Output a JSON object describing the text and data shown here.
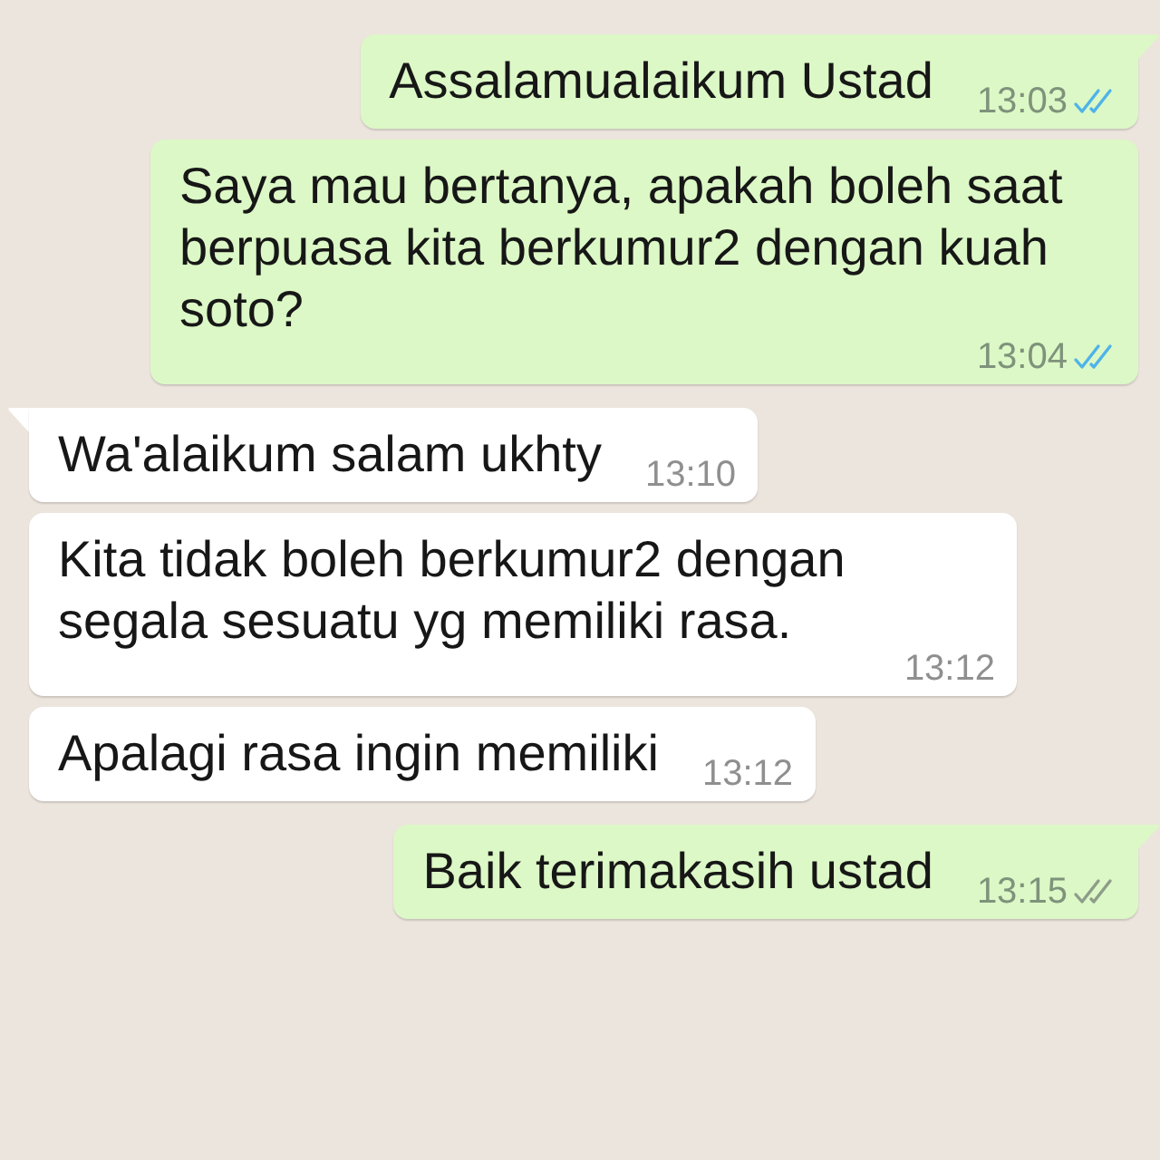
{
  "messages": [
    {
      "outgoing": true,
      "tail": true,
      "text": "Assalamualaikum Ustad",
      "time": "13:03",
      "read": true
    },
    {
      "outgoing": true,
      "tail": false,
      "text": "Saya mau bertanya, apakah boleh saat berpuasa kita berkumur2 dengan kuah soto?",
      "time": "13:04",
      "read": true
    },
    {
      "outgoing": false,
      "tail": true,
      "text": "Wa'alaikum salam ukhty",
      "time": "13:10"
    },
    {
      "outgoing": false,
      "tail": false,
      "text": "Kita tidak boleh berkumur2 dengan segala sesuatu yg memiliki rasa.",
      "time": "13:12"
    },
    {
      "outgoing": false,
      "tail": false,
      "text": "Apalagi rasa ingin memiliki",
      "time": "13:12"
    },
    {
      "outgoing": true,
      "tail": true,
      "text": "Baik terimakasih ustad",
      "time": "13:15",
      "read": false
    }
  ]
}
